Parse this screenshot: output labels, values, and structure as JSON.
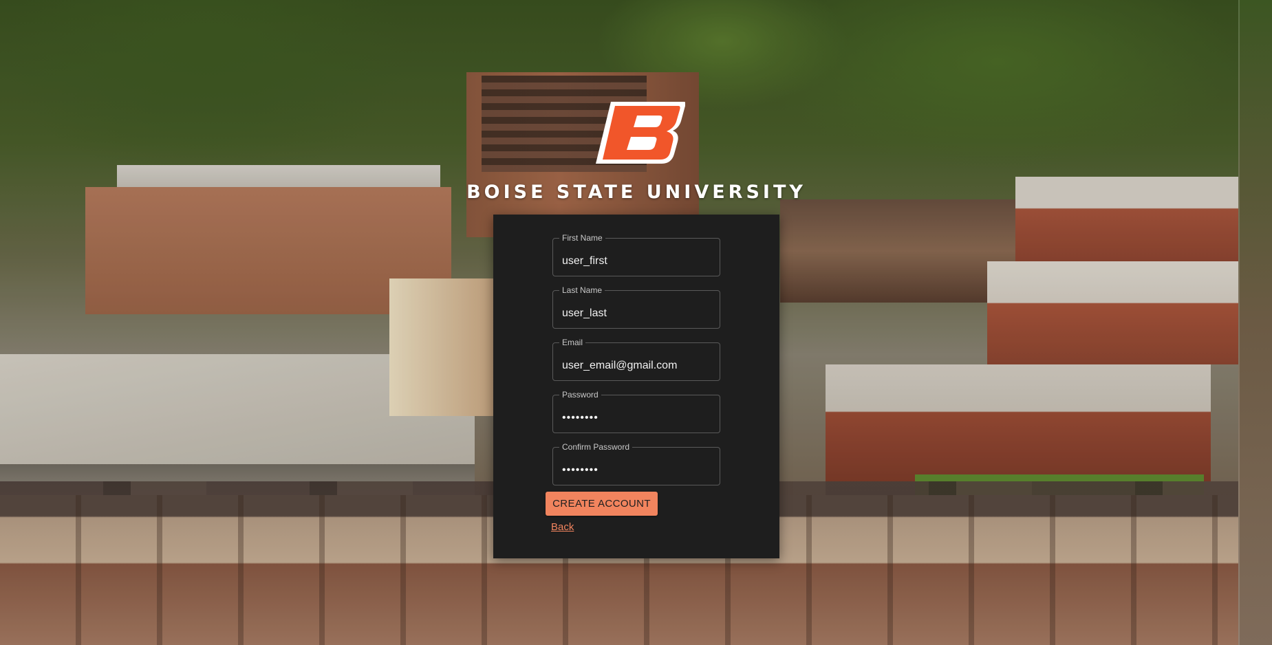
{
  "brand": {
    "name": "BOISE STATE UNIVERSITY",
    "logo_letter": "B",
    "colors": {
      "logo_orange": "#f1562a",
      "accent": "#f1845e",
      "panel_bg": "#1e1e1e"
    }
  },
  "form": {
    "fields": [
      {
        "label": "First Name",
        "value": "user_first",
        "type": "text"
      },
      {
        "label": "Last Name",
        "value": "user_last",
        "type": "text"
      },
      {
        "label": "Email",
        "value": "user_email@gmail.com",
        "type": "email"
      },
      {
        "label": "Password",
        "value": "••••••••",
        "type": "password"
      },
      {
        "label": "Confirm Password",
        "value": "••••••••",
        "type": "password"
      }
    ],
    "submit_label": "CREATE ACCOUNT",
    "back_label": "Back"
  }
}
